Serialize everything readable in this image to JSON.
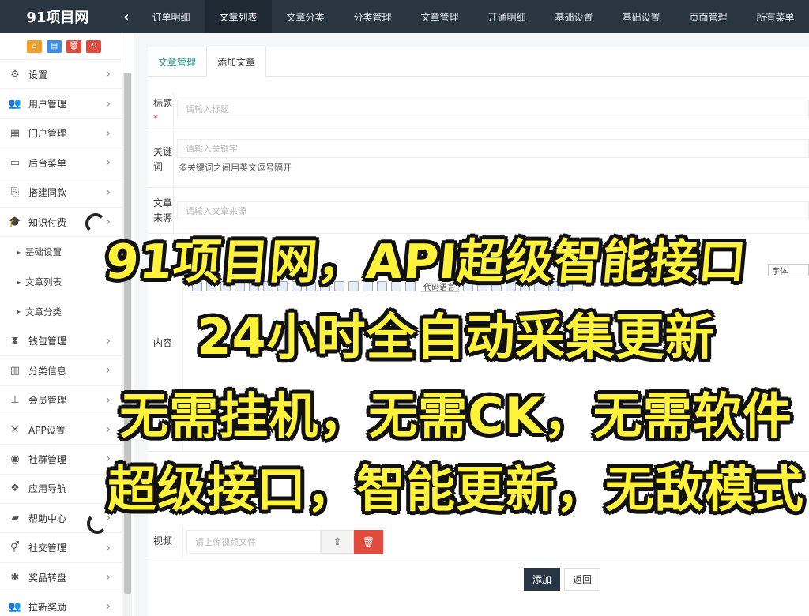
{
  "brand": "91项目网",
  "collapse_icon": "chevron-left-icon",
  "topnav": [
    "订单明细",
    "文章列表",
    "文章分类",
    "分类管理",
    "文章管理",
    "开通明细",
    "基础设置",
    "基础设置",
    "页面管理",
    "所有菜单"
  ],
  "sidebar": {
    "tools": [
      {
        "icon": "home-icon",
        "color": "#f0a030"
      },
      {
        "icon": "file-icon",
        "color": "#3a8ee6"
      },
      {
        "icon": "trash-icon",
        "color": "#e14b3e"
      },
      {
        "icon": "refresh-icon",
        "color": "#e14b3e"
      }
    ],
    "items": [
      {
        "label": "设置",
        "icon": "gears-icon"
      },
      {
        "label": "用户管理",
        "icon": "users-icon"
      },
      {
        "label": "门户管理",
        "icon": "grid-icon"
      },
      {
        "label": "后台菜单",
        "icon": "monitor-icon"
      },
      {
        "label": "搭建同款",
        "icon": "pdf-file-icon"
      },
      {
        "label": "知识付费",
        "icon": "graduation-cap-icon"
      }
    ],
    "subitems": [
      "基础设置",
      "文章列表",
      "文章分类"
    ],
    "items2": [
      {
        "label": "钱包管理",
        "icon": "hourglass-icon"
      },
      {
        "label": "分类信息",
        "icon": "map-icon"
      },
      {
        "label": "会员管理",
        "icon": "sitemap-icon"
      },
      {
        "label": "APP设置",
        "icon": "expand-icon"
      },
      {
        "label": "社群管理",
        "icon": "wechat-icon"
      },
      {
        "label": "应用导航",
        "icon": "cubes-icon"
      },
      {
        "label": "帮助中心",
        "icon": "book-icon"
      },
      {
        "label": "社交管理",
        "icon": "venus-mars-icon"
      },
      {
        "label": "奖品转盘",
        "icon": "asterisk-icon"
      },
      {
        "label": "拉新奖励",
        "icon": "users-icon"
      }
    ]
  },
  "tabs": {
    "manage": "文章管理",
    "add": "添加文章"
  },
  "form": {
    "title_label": "标题",
    "title_required": "*",
    "title_placeholder": "请输入标题",
    "keywords_label_1": "关键",
    "keywords_label_2": "词",
    "keywords_placeholder": "请输入关键字",
    "keywords_hint": "多关键词之间用英文逗号隔开",
    "source_label_1": "文章",
    "source_label_2": "来源",
    "source_placeholder": "请输入文章来源",
    "content_label": "内容",
    "editor_font_select": "字体",
    "editor_code_lang": "代码语言",
    "video_label": "视频",
    "video_placeholder": "请上传视频文件",
    "add_button": "添加",
    "back_button": "返回"
  },
  "overlay": {
    "line1": "91项目网，API超级智能接口",
    "line2": "24小时全自动采集更新",
    "line3": "无需挂机，无需CK，无需软件",
    "line4": "超级接口，智能更新，无敌模式",
    "color": "#fff23a"
  }
}
